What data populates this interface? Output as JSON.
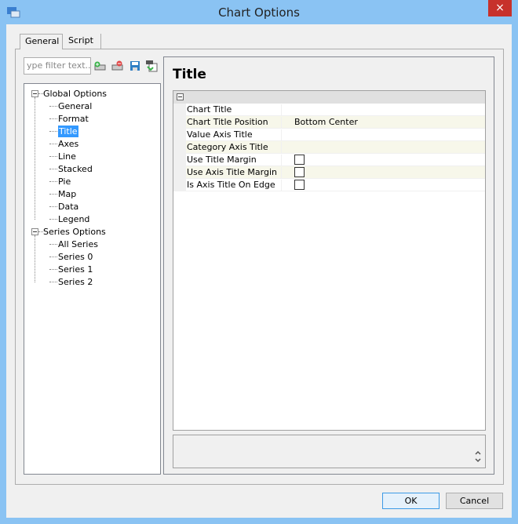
{
  "window": {
    "title": "Chart Options",
    "close_icon": "×"
  },
  "tabs": [
    "General",
    "Script"
  ],
  "filter": {
    "placeholder": "ype filter text..."
  },
  "toolbar_icons": [
    "add-icon",
    "remove-icon",
    "save-icon",
    "paste-icon"
  ],
  "tree": {
    "global": {
      "label": "Global Options",
      "children": [
        "General",
        "Format",
        "Title",
        "Axes",
        "Line",
        "Stacked",
        "Pie",
        "Map",
        "Data",
        "Legend"
      ]
    },
    "series": {
      "label": "Series Options",
      "children": [
        "All Series",
        "Series 0",
        "Series 1",
        "Series 2"
      ]
    },
    "selected": "Title"
  },
  "panel": {
    "title": "Title"
  },
  "properties": [
    {
      "name": "Chart Title",
      "value": ""
    },
    {
      "name": "Chart Title Position",
      "value": "Bottom Center"
    },
    {
      "name": "Value Axis Title",
      "value": ""
    },
    {
      "name": "Category Axis Title",
      "value": ""
    },
    {
      "name": "Use Title Margin",
      "checked": false
    },
    {
      "name": "Use Axis Title Margin",
      "checked": false
    },
    {
      "name": "Is Axis Title On Edge",
      "checked": false
    }
  ],
  "buttons": {
    "ok": "OK",
    "cancel": "Cancel"
  }
}
